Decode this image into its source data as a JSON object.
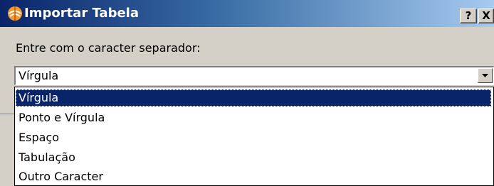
{
  "window": {
    "title": "Importar Tabela",
    "icon": "app-logo-icon",
    "help_label": "?",
    "close_label": "X"
  },
  "prompt": "Entre com o caracter separador:",
  "combo": {
    "selected": "Vírgula",
    "arrow_icon": "chevron-down-icon"
  },
  "options": [
    "Vírgula",
    "Ponto e Vírgula",
    "Espaço",
    "Tabulação",
    "Outro Caracter"
  ],
  "colors": {
    "title_start": "#0a246a",
    "title_end": "#a6caf0",
    "highlight": "#0a246a",
    "face": "#d4d0c8"
  }
}
